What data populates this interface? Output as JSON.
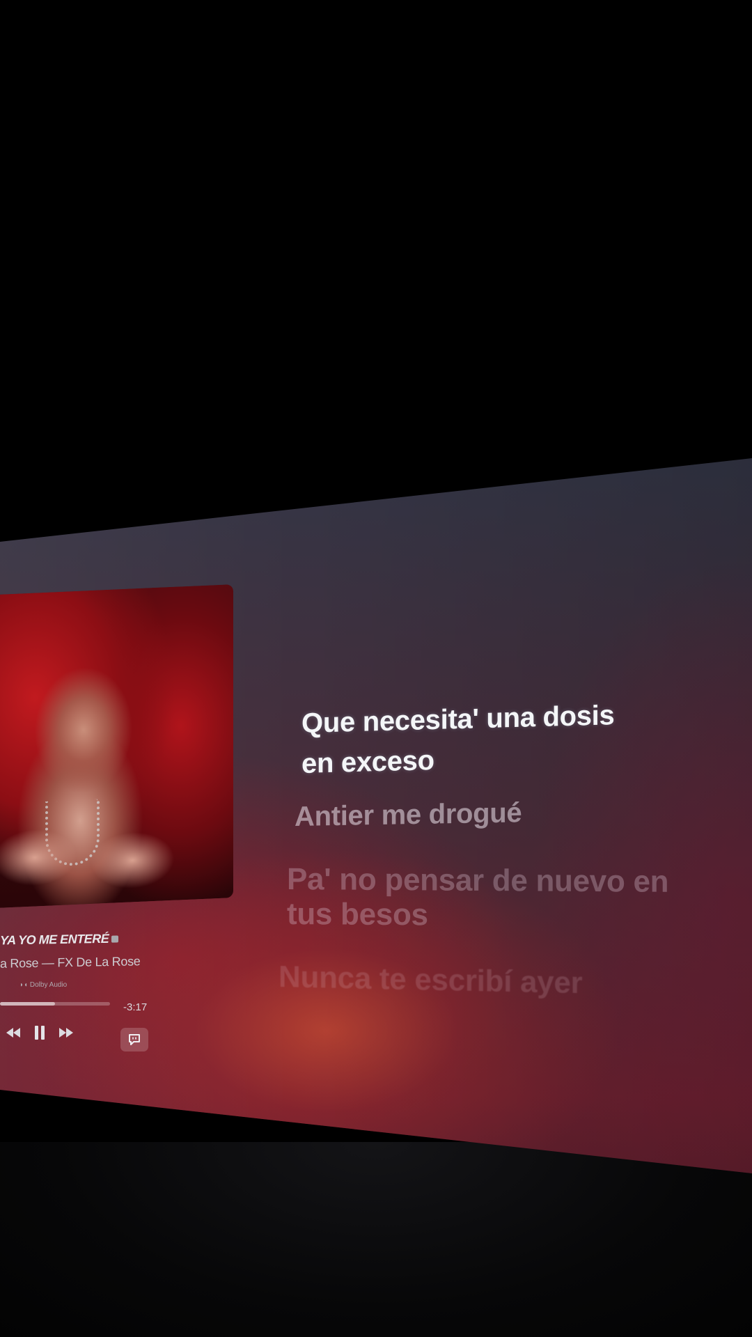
{
  "track": {
    "title": "YA YO ME ENTERÉ",
    "artist_line": "a Rose — FX De La Rose",
    "audio_format": "Dolby Audio",
    "time_remaining": "-3:17",
    "progress_fraction": 0.5
  },
  "controls": {
    "previous_icon": "rewind-icon",
    "play_pause_icon": "pause-icon",
    "next_icon": "fast-forward-icon",
    "lyrics_icon": "lyrics-icon"
  },
  "lyrics": {
    "current_line_1": "Que necesita' una dosis",
    "current_line_2": "en exceso",
    "next_line": "Antier me drogué",
    "following_line_1": "Pa' no pensar de nuevo en",
    "following_line_2": "tus besos",
    "later_line": "Nunca te escribí ayer"
  },
  "colors": {
    "background_top": "#2a2f3f",
    "background_bottom": "#6b2130",
    "active_lyric": "#f4f6f8"
  }
}
